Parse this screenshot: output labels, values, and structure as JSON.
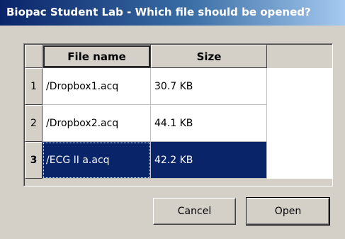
{
  "window": {
    "title": "Biopac Student Lab - Which file should be opened?"
  },
  "table": {
    "columns": [
      "File name",
      "Size"
    ],
    "rows": [
      {
        "num": "1",
        "file_name": "/Dropbox1.acq",
        "size": "30.7 KB",
        "selected": false
      },
      {
        "num": "2",
        "file_name": "/Dropbox2.acq",
        "size": "44.1 KB",
        "selected": false
      },
      {
        "num": "3",
        "file_name": "/ECG II a.acq",
        "size": "42.2 KB",
        "selected": true
      }
    ]
  },
  "buttons": {
    "cancel_label": "Cancel",
    "open_label": "Open"
  },
  "colors": {
    "selection": "#0a246a",
    "face": "#d4d0c8"
  }
}
